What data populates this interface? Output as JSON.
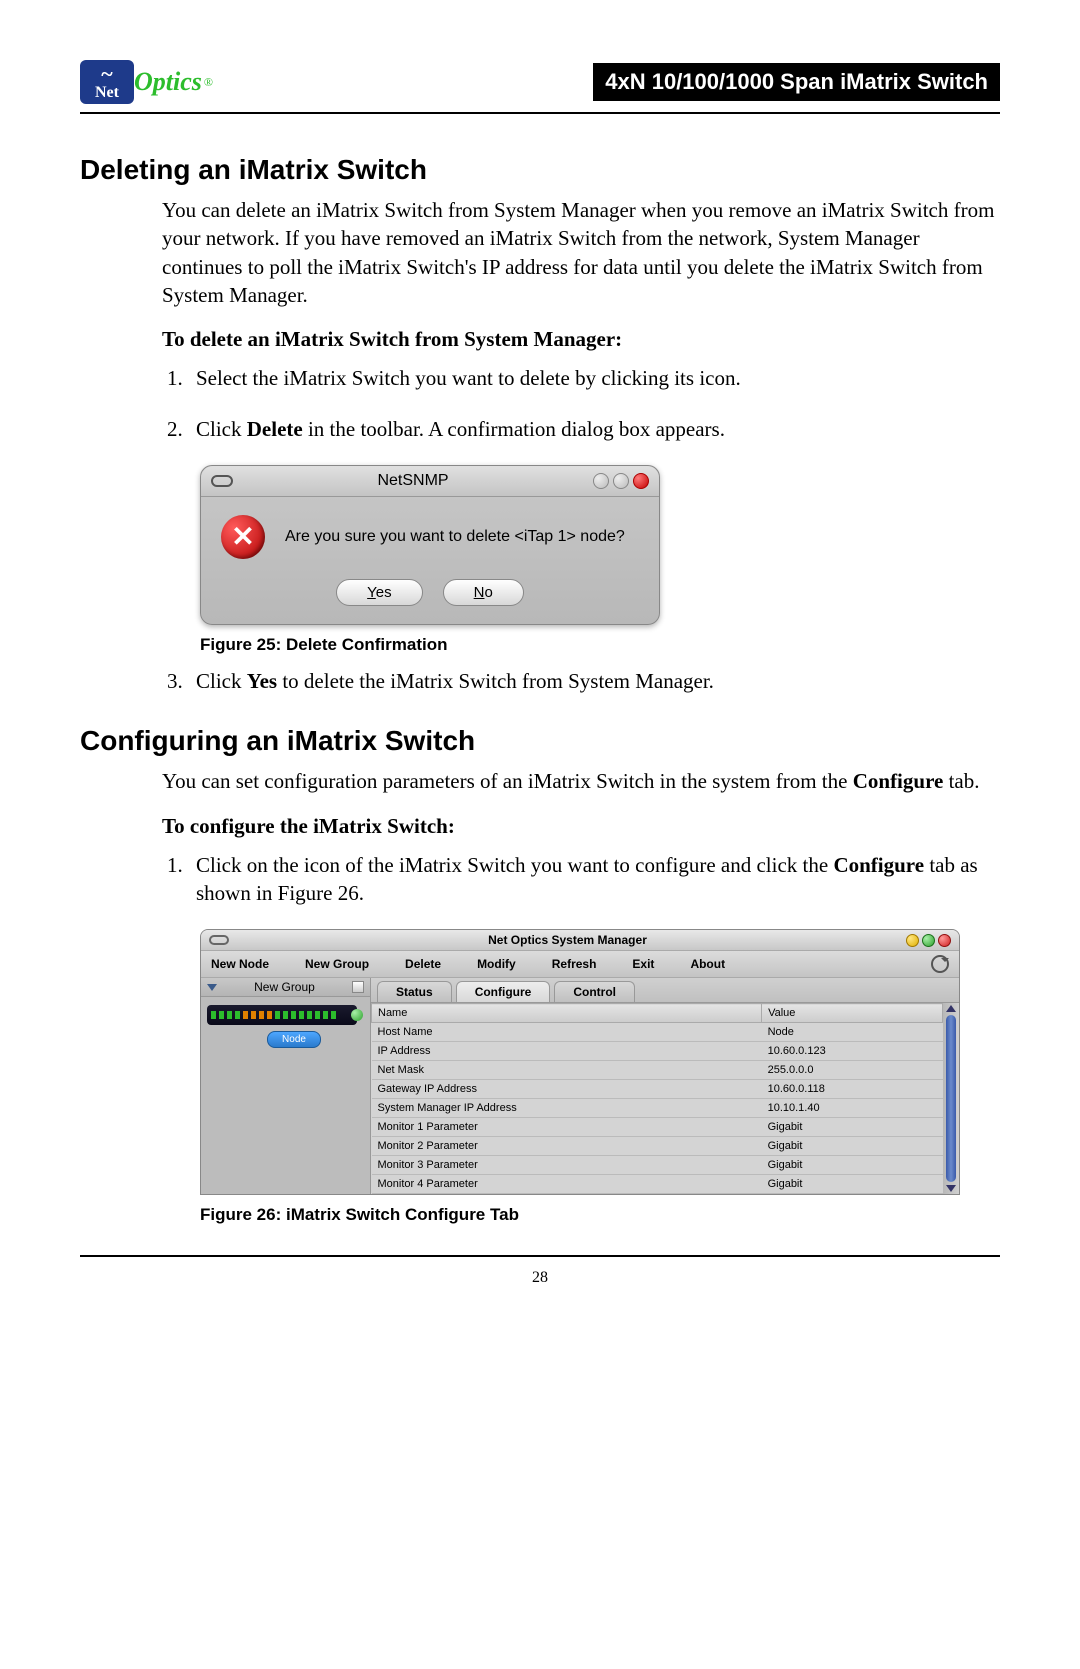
{
  "header": {
    "logo_net": "Net",
    "logo_optics": "Optics",
    "logo_reg": "®",
    "title_bar": "4xN 10/100/1000 Span iMatrix Switch"
  },
  "section1": {
    "heading": "Deleting an iMatrix Switch",
    "intro": "You can delete an iMatrix Switch from System Manager when you remove an iMatrix Switch from your network. If you have removed an iMatrix Switch from the network, System Manager continues to poll the iMatrix Switch's IP address for data until you delete the iMatrix Switch from System Manager.",
    "proc_head": "To delete an iMatrix Switch from System Manager:",
    "step1": "Select the iMatrix Switch you want to delete by clicking its icon.",
    "step2_pre": "Click ",
    "step2_bold": "Delete",
    "step2_post": " in the toolbar. A confirmation dialog box appears.",
    "fig25_label": "Figure 25: ",
    "fig25_caption": "Delete Confirmation",
    "step3_pre": "Click ",
    "step3_bold": "Yes",
    "step3_post": " to delete the iMatrix Switch from System Manager."
  },
  "dialog": {
    "title": "NetSNMP",
    "message": "Are you sure you want to delete <iTap 1> node?",
    "yes_u": "Y",
    "yes_rest": "es",
    "no_u": "N",
    "no_rest": "o"
  },
  "section2": {
    "heading": "Configuring an iMatrix Switch",
    "intro_pre": "You can set configuration parameters of an iMatrix Switch in the system from the ",
    "intro_bold": "Configure",
    "intro_post": " tab.",
    "proc_head": "To configure the iMatrix Switch:",
    "step1_pre": "Click on the icon of the iMatrix Switch you want to configure and click the ",
    "step1_bold": "Configure",
    "step1_post": " tab as shown in Figure 26.",
    "fig26_label": "Figure 26: ",
    "fig26_caption": "iMatrix Switch Configure Tab"
  },
  "sm": {
    "win_title": "Net Optics System Manager",
    "menu": [
      "New Node",
      "New Group",
      "Delete",
      "Modify",
      "Refresh",
      "Exit",
      "About"
    ],
    "tree_label": "New Group",
    "node_tag": "Node",
    "tabs": [
      "Status",
      "Configure",
      "Control"
    ],
    "col_name": "Name",
    "col_value": "Value",
    "rows": [
      {
        "name": "Host Name",
        "value": "Node"
      },
      {
        "name": "IP Address",
        "value": "10.60.0.123"
      },
      {
        "name": "Net Mask",
        "value": "255.0.0.0"
      },
      {
        "name": "Gateway IP Address",
        "value": "10.60.0.118"
      },
      {
        "name": "System Manager IP Address",
        "value": "10.10.1.40"
      },
      {
        "name": "Monitor 1 Parameter",
        "value": "Gigabit"
      },
      {
        "name": "Monitor 2 Parameter",
        "value": "Gigabit"
      },
      {
        "name": "Monitor 3 Parameter",
        "value": "Gigabit"
      },
      {
        "name": "Monitor 4 Parameter",
        "value": "Gigabit"
      }
    ]
  },
  "page_number": "28"
}
